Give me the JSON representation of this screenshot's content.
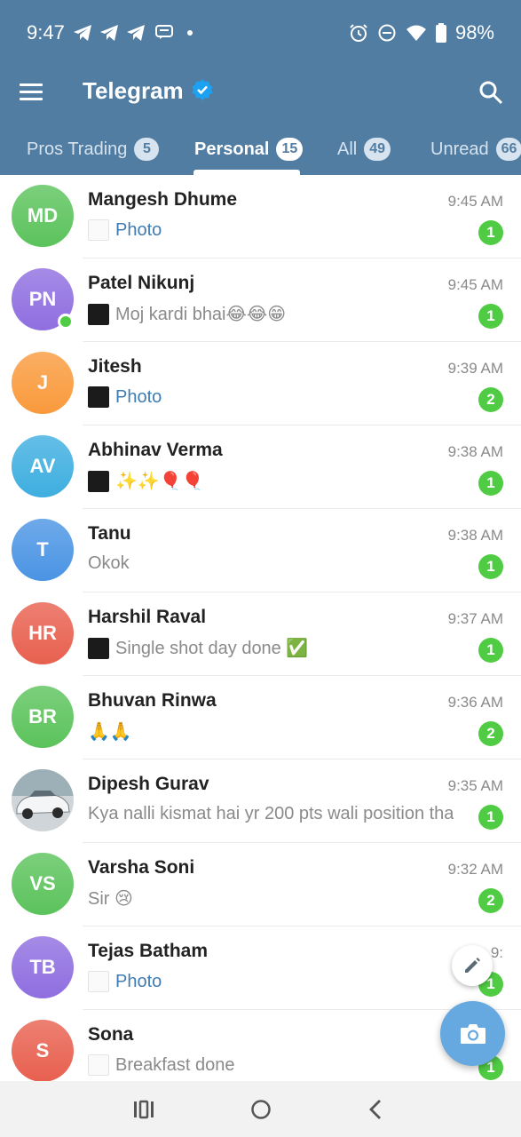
{
  "status_bar": {
    "time": "9:47",
    "battery": "98%",
    "icons": [
      "telegram-icon",
      "telegram-icon",
      "telegram-icon",
      "message-icon",
      "alarm-icon",
      "do-not-disturb-icon",
      "wifi-icon",
      "battery-icon"
    ]
  },
  "app": {
    "title": "Telegram",
    "header_color": "#517da2",
    "verified_color": "#1da1f2"
  },
  "tabs": [
    {
      "label": "Pros Trading",
      "count": "5",
      "active": false
    },
    {
      "label": "Personal",
      "count": "15",
      "active": true
    },
    {
      "label": "All",
      "count": "49",
      "active": false
    },
    {
      "label": "Unread",
      "count": "66",
      "active": false
    }
  ],
  "chats": [
    {
      "initials": "MD",
      "name": "Mangesh Dhume",
      "time": "9:45 AM",
      "preview": "Photo",
      "unread": "1",
      "avatar_color": "#5bc35b",
      "media": true
    },
    {
      "initials": "PN",
      "name": "Patel Nikunj",
      "time": "9:45 AM",
      "preview": "Moj kardi bhai😂😂😁",
      "unread": "1",
      "avatar_color": "#8f6ee0",
      "online": true
    },
    {
      "initials": "J",
      "name": "Jitesh",
      "time": "9:39 AM",
      "preview": "Photo",
      "unread": "2",
      "avatar_color": "#f99a3c",
      "media": true
    },
    {
      "initials": "AV",
      "name": "Abhinav Verma",
      "time": "9:38 AM",
      "preview": "✨✨🎈🎈",
      "unread": "1",
      "avatar_color": "#3eaee0"
    },
    {
      "initials": "T",
      "name": "Tanu",
      "time": "9:38 AM",
      "preview": "Okok",
      "unread": "1",
      "avatar_color": "#4a94e4"
    },
    {
      "initials": "HR",
      "name": "Harshil Raval",
      "time": "9:37 AM",
      "preview": "Single shot day done ✅",
      "unread": "1",
      "avatar_color": "#e8604f"
    },
    {
      "initials": "BR",
      "name": "Bhuvan Rinwa",
      "time": "9:36 AM",
      "preview": "🙏🙏",
      "unread": "2",
      "avatar_color": "#5bc35b"
    },
    {
      "initials": "",
      "name": "Dipesh Gurav",
      "time": "9:35 AM",
      "preview": "Kya nalli kismat hai yr 200 pts wali position tha",
      "unread": "1",
      "avatar_color": "#9aa4ad",
      "photo_avatar": true
    },
    {
      "initials": "VS",
      "name": "Varsha Soni",
      "time": "9:32 AM",
      "preview": "Sir 😢",
      "unread": "2",
      "avatar_color": "#5bc35b"
    },
    {
      "initials": "TB",
      "name": "Tejas Batham",
      "time": "9:",
      "preview": "Photo",
      "unread": "1",
      "avatar_color": "#8f6ee0",
      "media": true
    },
    {
      "initials": "S",
      "name": "Sona",
      "time": "",
      "preview": "Breakfast done",
      "unread": "1",
      "avatar_color": "#e8604f"
    }
  ],
  "fab": {
    "edit_icon": "pencil-icon",
    "camera_icon": "camera-icon",
    "camera_color": "#65a9e0"
  },
  "nav": {
    "icons": [
      "recent-apps-icon",
      "home-icon",
      "back-icon"
    ]
  }
}
